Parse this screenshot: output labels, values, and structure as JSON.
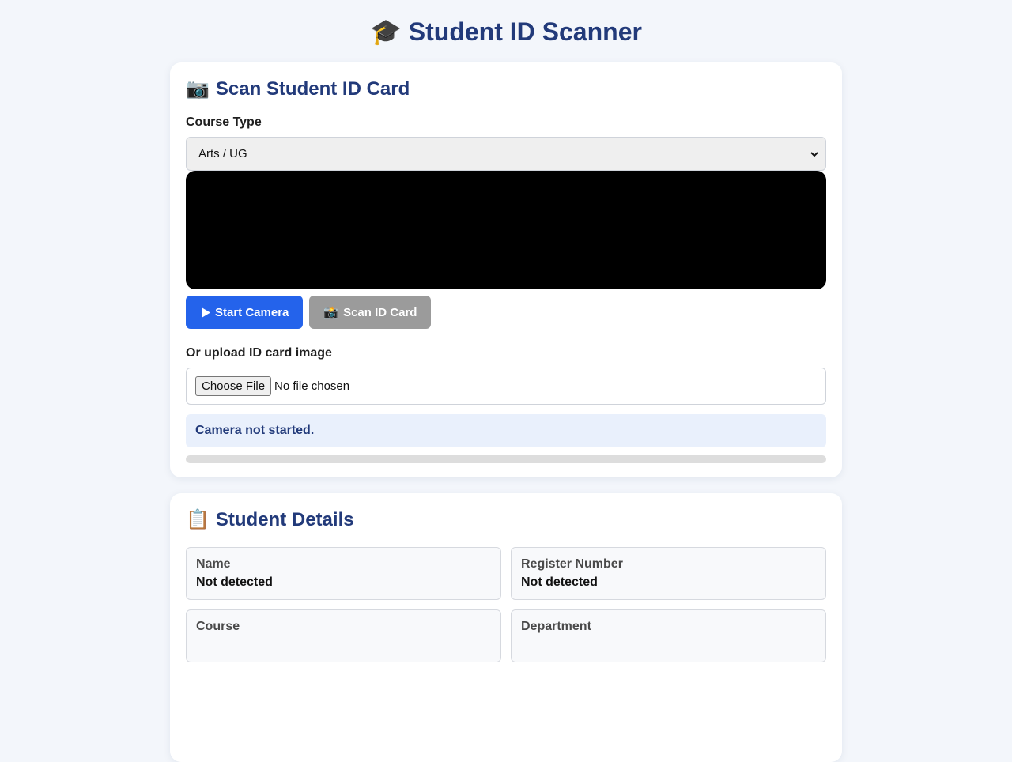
{
  "page": {
    "title": "Student ID Scanner",
    "title_emoji": "🎓"
  },
  "scan_card": {
    "title": "Scan Student ID Card",
    "title_emoji": "📷",
    "course_label": "Course Type",
    "course_selected": "Arts / UG",
    "start_camera_label": "Start Camera",
    "scan_id_label": "Scan ID Card",
    "scan_id_emoji": "📸",
    "upload_label": "Or upload ID card image",
    "file_button_label": "Choose File",
    "file_status": "No file chosen",
    "status_message": "Camera not started.",
    "progress_percent": 0
  },
  "details_card": {
    "title": "Student Details",
    "title_emoji": "📋",
    "fields": [
      {
        "label": "Name",
        "value": "Not detected"
      },
      {
        "label": "Register Number",
        "value": "Not detected"
      },
      {
        "label": "Course",
        "value": ""
      },
      {
        "label": "Department",
        "value": ""
      }
    ]
  },
  "colors": {
    "accent": "#2463eb",
    "heading": "#223a7a",
    "disabled": "#9b9b9b",
    "status_bg": "#e9f0fc"
  },
  "icons": {
    "start_camera": "play-icon",
    "select": "chevron-down-icon"
  }
}
